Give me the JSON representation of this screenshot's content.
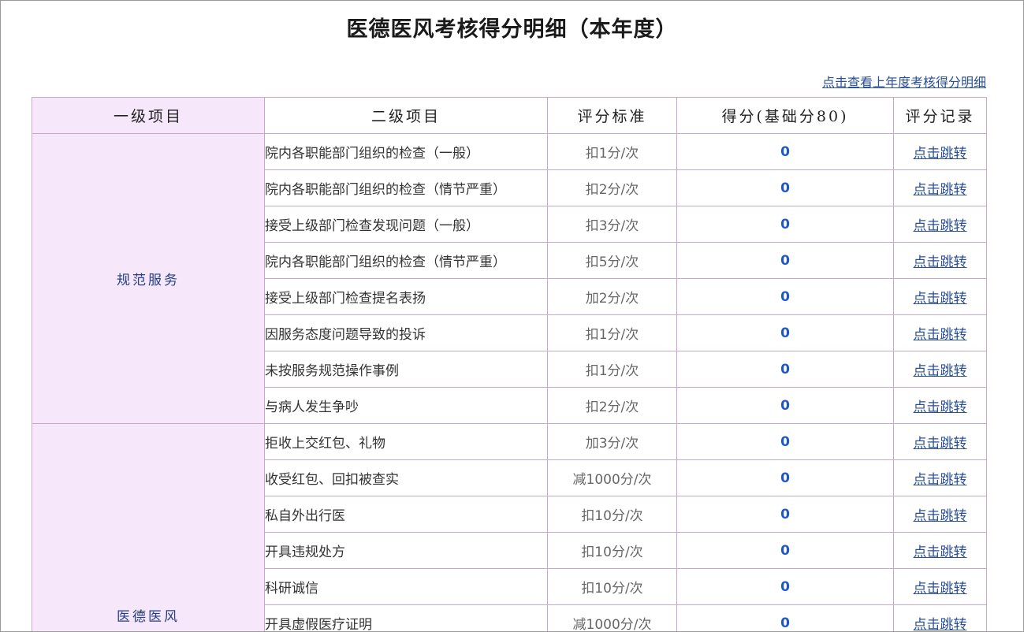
{
  "page": {
    "title": "医德医风考核得分明细（本年度）",
    "prev_year_link": "点击查看上年度考核得分明细"
  },
  "table": {
    "headers": [
      "一级项目",
      "二级项目",
      "评分标准",
      "得分(基础分80)",
      "评分记录"
    ],
    "groups": [
      {
        "category": "规范服务",
        "rows": [
          {
            "item": "院内各职能部门组织的检查（一般）",
            "standard": "扣1分/次",
            "score": "0",
            "record": "点击跳转"
          },
          {
            "item": "院内各职能部门组织的检查（情节严重）",
            "standard": "扣2分/次",
            "score": "0",
            "record": "点击跳转"
          },
          {
            "item": "接受上级部门检查发现问题（一般）",
            "standard": "扣3分/次",
            "score": "0",
            "record": "点击跳转"
          },
          {
            "item": "院内各职能部门组织的检查（情节严重）",
            "standard": "扣5分/次",
            "score": "0",
            "record": "点击跳转"
          },
          {
            "item": "接受上级部门检查提名表扬",
            "standard": "加2分/次",
            "score": "0",
            "record": "点击跳转"
          },
          {
            "item": "因服务态度问题导致的投诉",
            "standard": "扣1分/次",
            "score": "0",
            "record": "点击跳转"
          },
          {
            "item": "未按服务规范操作事例",
            "standard": "扣1分/次",
            "score": "0",
            "record": "点击跳转"
          },
          {
            "item": "与病人发生争吵",
            "standard": "扣2分/次",
            "score": "0",
            "record": "点击跳转"
          }
        ]
      },
      {
        "category": "医德医风",
        "rows": [
          {
            "item": "拒收上交红包、礼物",
            "standard": "加3分/次",
            "score": "0",
            "record": "点击跳转"
          },
          {
            "item": "收受红包、回扣被查实",
            "standard": "减1000分/次",
            "score": "0",
            "record": "点击跳转"
          },
          {
            "item": "私自外出行医",
            "standard": "扣10分/次",
            "score": "0",
            "record": "点击跳转"
          },
          {
            "item": "开具违规处方",
            "standard": "扣10分/次",
            "score": "0",
            "record": "点击跳转"
          },
          {
            "item": "科研诚信",
            "standard": "扣10分/次",
            "score": "0",
            "record": "点击跳转"
          },
          {
            "item": "开具虚假医疗证明",
            "standard": "减1000分/次",
            "score": "0",
            "record": "点击跳转"
          }
        ]
      }
    ]
  },
  "colors": {
    "category_bg": "#f6e7fa",
    "border": "#c9a6cc",
    "link": "#2a4f94",
    "score": "#1f56c8"
  }
}
